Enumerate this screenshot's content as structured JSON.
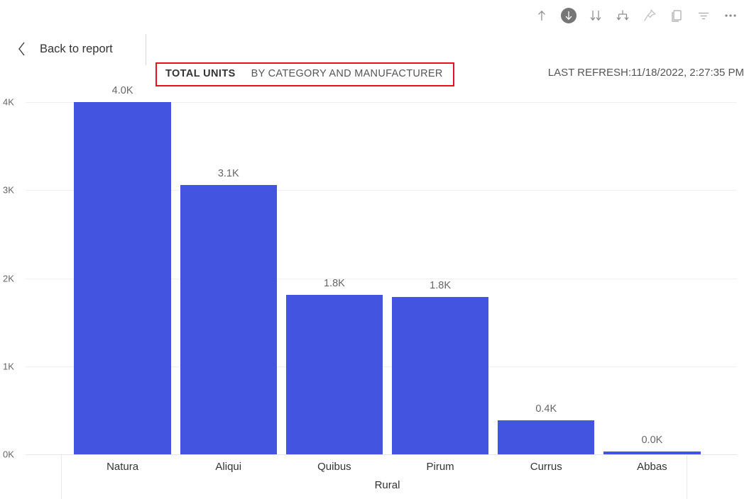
{
  "toolbar": {
    "buttons": [
      {
        "name": "export-up-icon",
        "label": "Export"
      },
      {
        "name": "download-circle-icon",
        "label": "Download"
      },
      {
        "name": "drill-down-icon",
        "label": "Drill down"
      },
      {
        "name": "expand-all-icon",
        "label": "Expand all down one level"
      },
      {
        "name": "pin-icon",
        "label": "Pin visual"
      },
      {
        "name": "focus-mode-icon",
        "label": "Focus mode"
      },
      {
        "name": "filter-icon",
        "label": "Filters"
      },
      {
        "name": "more-options-icon",
        "label": "More options"
      }
    ]
  },
  "header": {
    "back_label": "Back to report",
    "title_strong": "TOTAL UNITS",
    "title_sub": "BY CATEGORY AND MANUFACTURER",
    "last_refresh": "LAST REFRESH:11/18/2022, 2:27:35 PM",
    "highlight_color": "#e81123"
  },
  "chart_data": {
    "type": "bar",
    "title": "TOTAL UNITS BY CATEGORY AND MANUFACTURER",
    "xlabel": "Rural",
    "ylabel": "",
    "categories": [
      "Natura",
      "Aliqui",
      "Quibus",
      "Pirum",
      "Currus",
      "Abbas"
    ],
    "values": [
      4000,
      3060,
      1810,
      1790,
      390,
      10
    ],
    "data_labels": [
      "4.0K",
      "3.1K",
      "1.8K",
      "1.8K",
      "0.4K",
      "0.0K"
    ],
    "ytick_labels": [
      "0K",
      "1K",
      "2K",
      "3K",
      "4K"
    ],
    "ytick_values": [
      0,
      1000,
      2000,
      3000,
      4000
    ],
    "ylim": [
      0,
      4000
    ],
    "grid": true,
    "legend": "none",
    "series_color": "#4355e0",
    "group_label": "Rural"
  }
}
